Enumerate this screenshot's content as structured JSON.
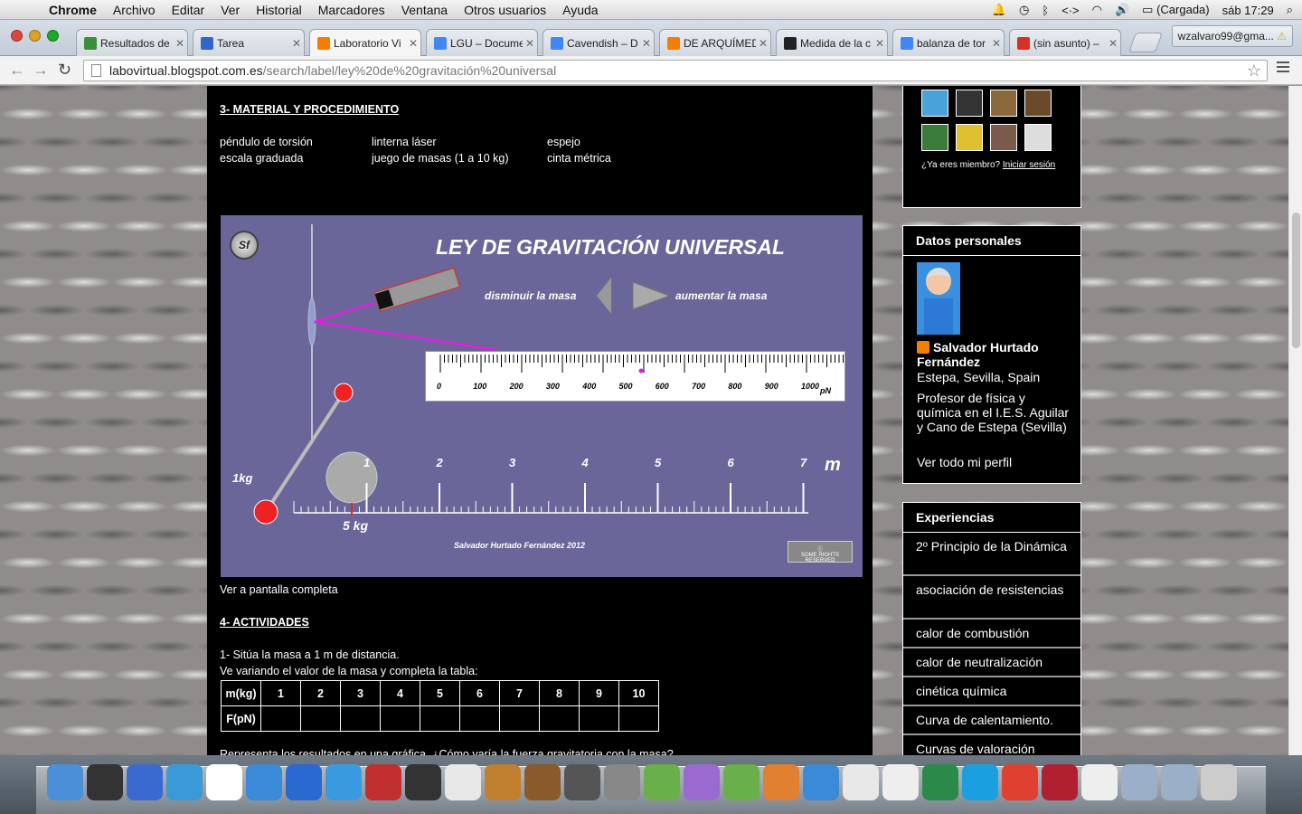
{
  "menubar": {
    "app": "Chrome",
    "items": [
      "Archivo",
      "Editar",
      "Ver",
      "Historial",
      "Marcadores",
      "Ventana",
      "Otros usuarios",
      "Ayuda"
    ],
    "battery": "(Cargada)",
    "clock": "sáb 17:29"
  },
  "tabs": [
    {
      "title": "Resultados de",
      "color": "#3a8f3a"
    },
    {
      "title": "Tarea",
      "color": "#3366cc"
    },
    {
      "title": "Laboratorio Vi",
      "color": "#f57d00"
    },
    {
      "title": "LGU – Docume",
      "color": "#4285f4"
    },
    {
      "title": "Cavendish – D",
      "color": "#4285f4"
    },
    {
      "title": "DE ARQUÍMEDI",
      "color": "#f57d00"
    },
    {
      "title": "Medida de la c",
      "color": "#222222"
    },
    {
      "title": "balanza de tor",
      "color": "#4285f4"
    },
    {
      "title": "(sin asunto) – ",
      "color": "#d93025"
    }
  ],
  "profile": "wzalvaro99@gma...",
  "url": {
    "host": "labovirtual.blogspot.com.es",
    "path": "/search/label/ley%20de%20gravitación%20universal"
  },
  "main": {
    "section3": "3- MATERIAL Y PROCEDIMIENTO",
    "materials": [
      "péndulo de torsión",
      "linterna láser",
      "espejo",
      "escala graduada",
      "juego de masas (1 a 10 kg)",
      "cinta métrica"
    ],
    "fullscreen": "Ver a pantalla completa",
    "section4": "4- ACTIVIDADES",
    "activity1": "1- Sitúa la masa a 1 m de distancia.",
    "activity1b": "Ve variando el valor de la masa y completa la tabla:",
    "cutoff": "Representa los resultados en una gráfica. ¿Cómo varía la fuerza gravitatoria con la masa?"
  },
  "sim": {
    "logo": "Sf",
    "title": "LEY DE GRAVITACIÓN UNIVERSAL",
    "decrease": "disminuir la masa",
    "increase": "aumentar la masa",
    "ruler_ticks": [
      "0",
      "100",
      "200",
      "300",
      "400",
      "500",
      "600",
      "700",
      "800",
      "900",
      "1000"
    ],
    "ruler_unit": "pN",
    "distance_ticks": [
      "1",
      "2",
      "3",
      "4",
      "5",
      "6",
      "7"
    ],
    "distance_unit": "m",
    "small_mass": "1kg",
    "big_mass": "5 kg",
    "author": "Salvador Hurtado Fernández 2012",
    "license": "SOME RIGHTS RESERVED"
  },
  "table": {
    "row1": [
      "m(kg)",
      "1",
      "2",
      "3",
      "4",
      "5",
      "6",
      "7",
      "8",
      "9",
      "10"
    ],
    "row2": [
      "F(pN)",
      "",
      "",
      "",
      "",
      "",
      "",
      "",
      "",
      "",
      ""
    ]
  },
  "sidebar": {
    "member_q": "¿Ya eres miembro?",
    "login": "Iniciar sesión",
    "profile_header": "Datos personales",
    "name": "Salvador Hurtado Fernández",
    "location": "Estepa, Sevilla, Spain",
    "bio": "Profesor de física y química en el I.E.S. Aguilar y Cano de Estepa (Sevilla)",
    "view_profile": "Ver todo mi perfil",
    "exp_header": "Experiencias",
    "exp_items": [
      "2º Principio de la Dinámica",
      "asociación de resistencias",
      "calor de combustión",
      "calor de neutralización",
      "cinética química",
      "Curva de calentamiento.",
      "Curvas de valoración ácido-base"
    ]
  }
}
